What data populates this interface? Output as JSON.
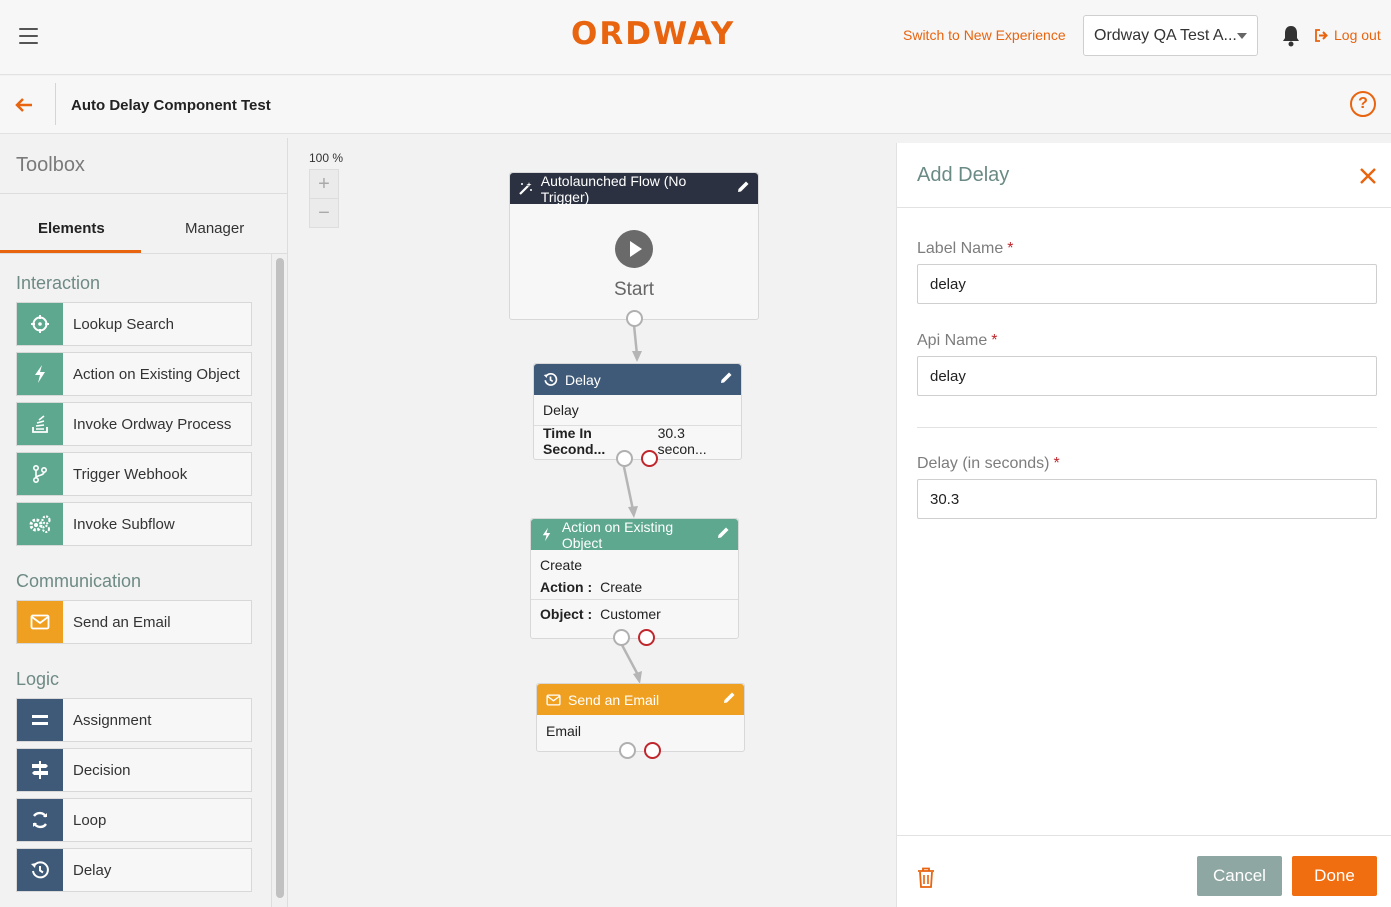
{
  "header": {
    "logo": "ORDWAY",
    "switch_link": "Switch to New Experience",
    "account_select": "Ordway QA Test A...",
    "logout": "Log out"
  },
  "subheader": {
    "title": "Auto Delay Component Test",
    "help": "?"
  },
  "toolbox": {
    "title": "Toolbox",
    "tabs": [
      "Elements",
      "Manager"
    ],
    "sections": {
      "interaction": "Interaction",
      "communication": "Communication",
      "logic": "Logic"
    },
    "interaction_items": [
      "Lookup Search",
      "Action on Existing Object",
      "Invoke Ordway Process",
      "Trigger Webhook",
      "Invoke Subflow"
    ],
    "communication_items": [
      "Send an Email"
    ],
    "logic_items": [
      "Assignment",
      "Decision",
      "Loop",
      "Delay"
    ]
  },
  "canvas": {
    "zoom": "100 %",
    "zoom_in": "+",
    "zoom_out": "−",
    "start_node": {
      "title": "Autolaunched Flow (No Trigger)",
      "label": "Start"
    },
    "delay_node": {
      "title": "Delay",
      "type": "Delay",
      "field_label": "Time In Second...",
      "field_value": "30.3 secon..."
    },
    "action_node": {
      "title": "Action on Existing Object",
      "type": "Create",
      "action_label": "Action :",
      "action_value": "Create",
      "object_label": "Object :",
      "object_value": "Customer"
    },
    "email_node": {
      "title": "Send an Email",
      "type": "Email"
    }
  },
  "panel": {
    "title": "Add Delay",
    "label_name": {
      "label": "Label Name",
      "value": "delay"
    },
    "api_name": {
      "label": "Api Name",
      "value": "delay"
    },
    "delay_seconds": {
      "label": "Delay (in seconds)",
      "value": "30.3"
    },
    "required_mark": "*",
    "cancel": "Cancel",
    "done": "Done"
  },
  "colors": {
    "accent": "#e8640f",
    "interaction": "#5ea88f",
    "communication": "#f0a020",
    "logic": "#3f5a78",
    "required": "#c0272d"
  }
}
